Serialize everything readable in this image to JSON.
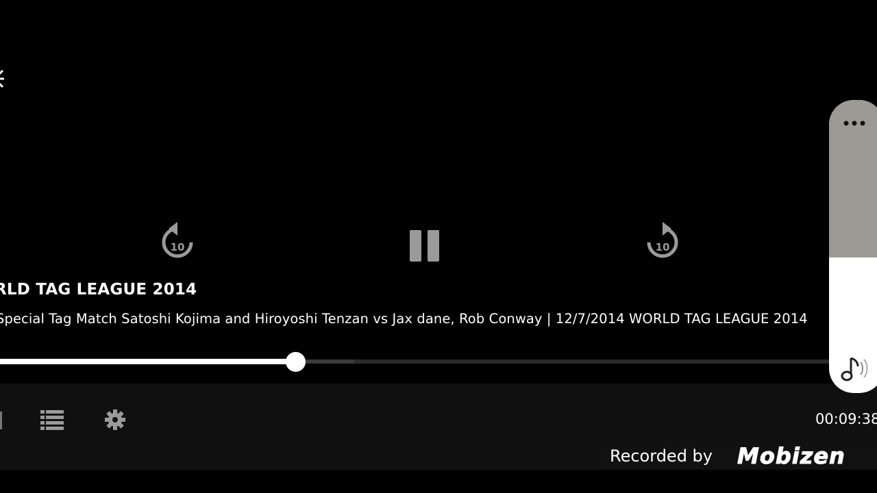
{
  "player": {
    "title": "RLD TAG LEAGUE 2014",
    "subtitle": "Special Tag Match Satoshi Kojima and Hiroyoshi Tenzan vs Jax dane, Rob Conway | 12/7/2014 WORLD TAG LEAGUE 2014",
    "time": "00:09:38",
    "progress_fraction": 0.35,
    "buffer_fraction": 0.42,
    "rewind_label": "10",
    "forward_label": "10"
  },
  "controls": {
    "back": "back-icon",
    "rewind": "rewind-10-icon",
    "pause": "pause-icon",
    "forward": "forward-10-icon",
    "playlist": "playlist-icon",
    "settings": "gear-icon"
  },
  "overlay": {
    "recorded_label": "Recorded by",
    "brand": "Mobizen",
    "side_menu_icon": "more-dots-icon",
    "side_audio_icon": "audio-icon"
  },
  "colors": {
    "background": "#000000",
    "control_gray": "#9a9a9a",
    "progress": "#ffffff",
    "panel_gray": "#9d9a95"
  }
}
